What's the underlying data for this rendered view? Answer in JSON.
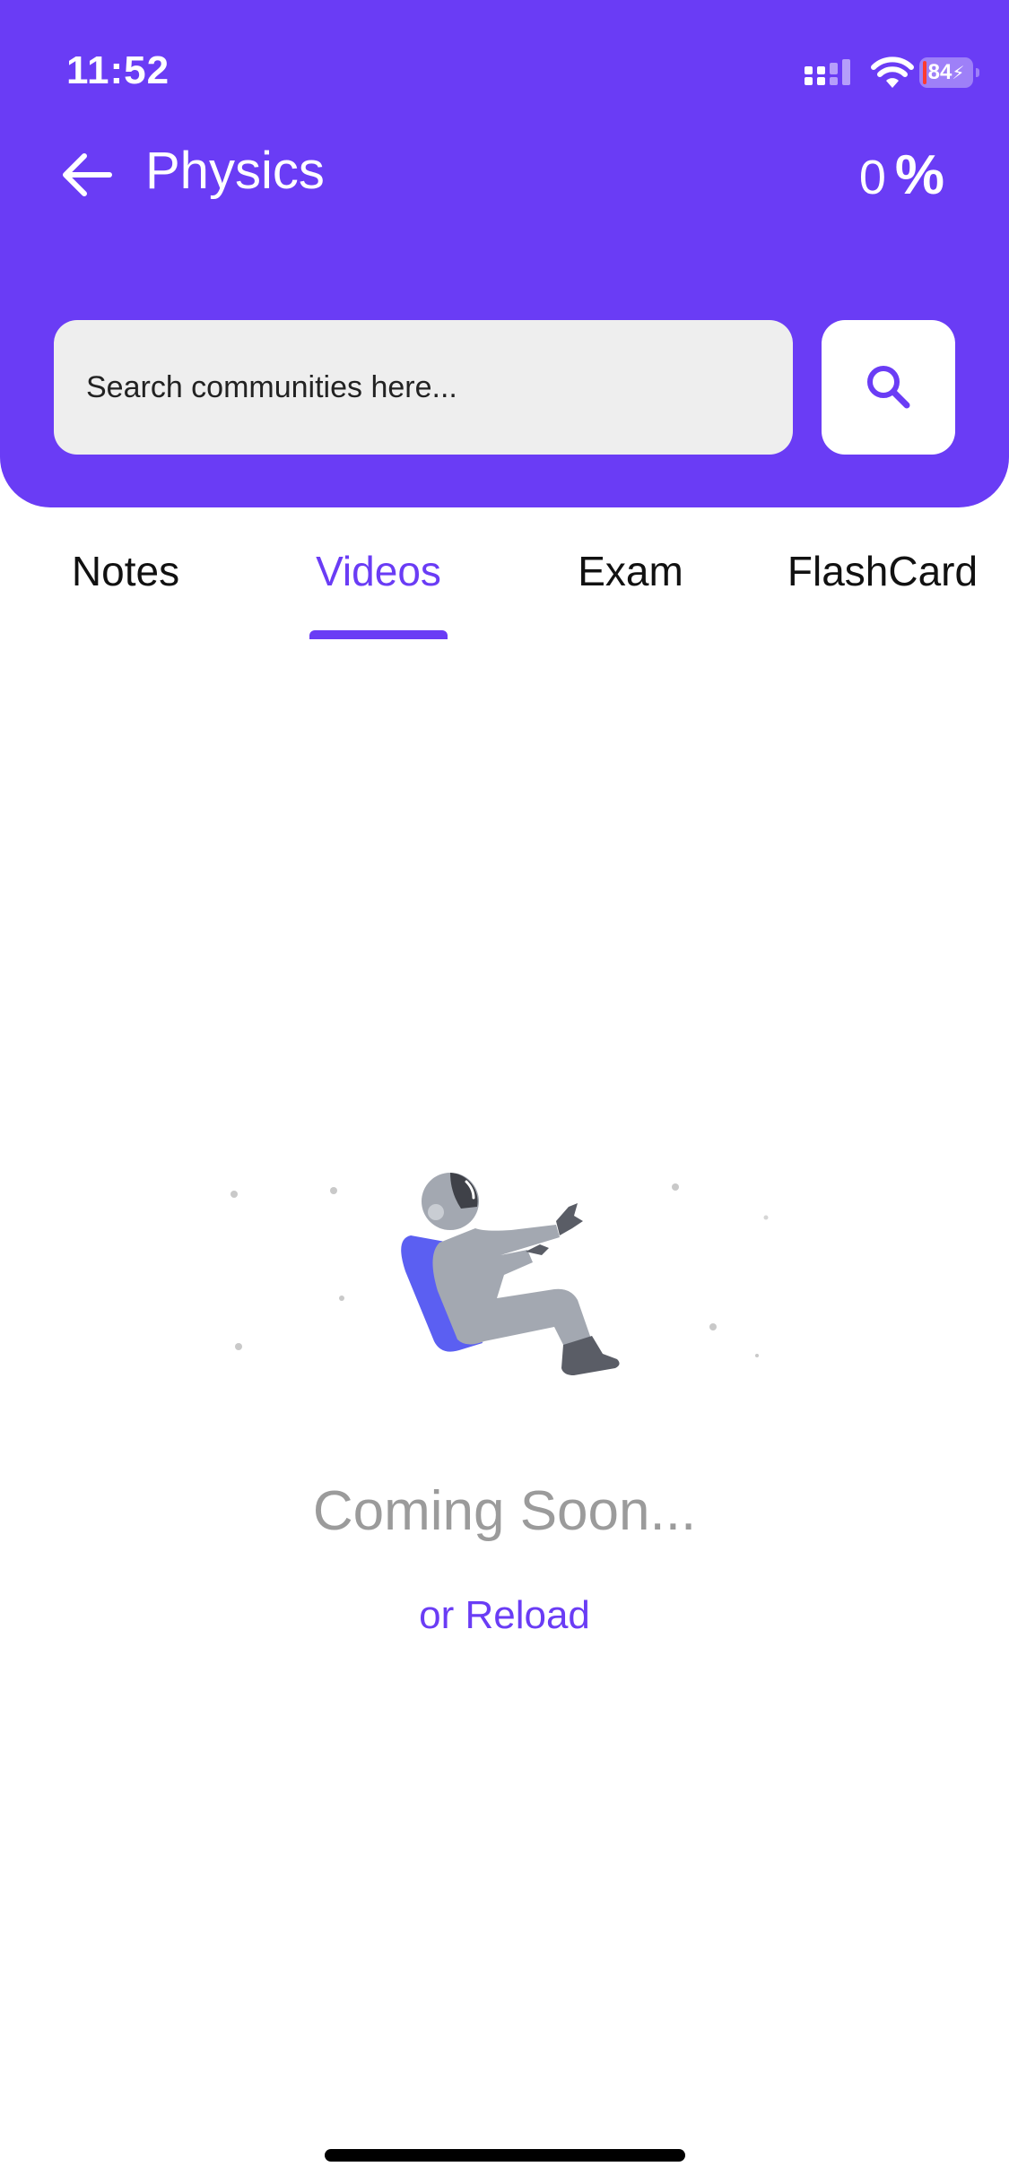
{
  "status_bar": {
    "time": "11:52",
    "battery": "84"
  },
  "header": {
    "title": "Physics",
    "progress_value": "0",
    "progress_symbol": "%"
  },
  "search": {
    "placeholder": "Search communities here...",
    "value": ""
  },
  "tabs": [
    {
      "label": "Notes",
      "active": false
    },
    {
      "label": "Videos",
      "active": true
    },
    {
      "label": "Exam",
      "active": false
    },
    {
      "label": "FlashCard",
      "active": false
    }
  ],
  "empty_state": {
    "title": "Coming Soon...",
    "reload_label": "or Reload"
  },
  "colors": {
    "accent": "#6a3cf5",
    "search_bg": "#eeeeee",
    "muted_text": "#9b9b9b"
  },
  "icons": [
    "back-arrow-icon",
    "search-icon",
    "signal-icon",
    "wifi-icon",
    "battery-icon"
  ]
}
